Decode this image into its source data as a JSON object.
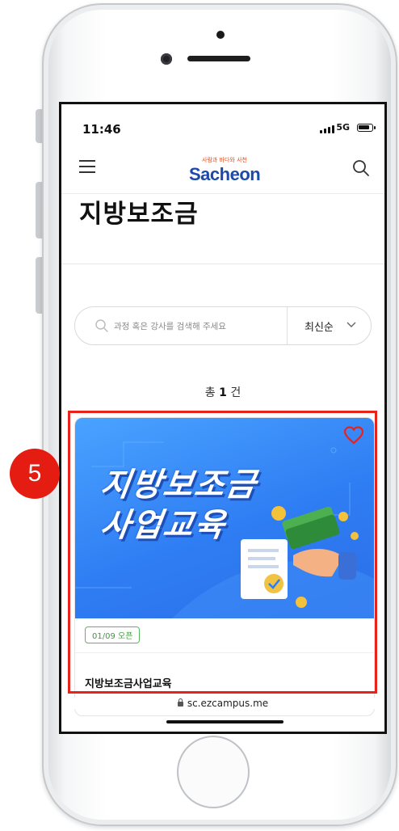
{
  "status_bar": {
    "time": "11:46",
    "network": "5G"
  },
  "header": {
    "logo_text": "Sacheon",
    "logo_tagline": "사람과 바다와 사천"
  },
  "page": {
    "title": "지방보조금",
    "search_placeholder": "과정 혹은 강사를 검색해 주세요",
    "sort_label": "최신순",
    "total_prefix": "총",
    "total_count": "1",
    "total_suffix": "건"
  },
  "course": {
    "thumbnail_line1": "지방보조금",
    "thumbnail_line2": "사업교육",
    "badge": "01/09 오픈",
    "title": "지방보조금사업교육"
  },
  "browser": {
    "url": "sc.ezcampus.me"
  },
  "annotation": {
    "step_number": "5"
  },
  "colors": {
    "accent_red": "#e8231b",
    "brand_blue": "#1d4aa8",
    "thumbnail_blue": "#2f7df3",
    "badge_green": "#3c9a3c"
  }
}
